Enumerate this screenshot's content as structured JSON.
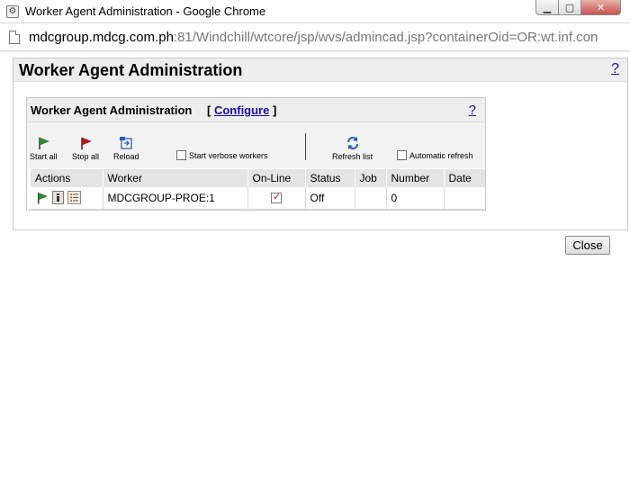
{
  "window": {
    "title": "Worker Agent Administration - Google Chrome",
    "url_host": "mdcgroup.mdcg.com.ph",
    "url_rest": ":81/Windchill/wtcore/jsp/wvs/admincad.jsp?containerOid=OR:wt.inf.con"
  },
  "page": {
    "title": "Worker Agent Administration",
    "help_label": "?"
  },
  "panel": {
    "title": "Worker Agent Administration",
    "configure_open": "[",
    "configure_label": "Configure",
    "configure_close": "]",
    "help_label": "?"
  },
  "toolbar": {
    "start_all": "Start all",
    "stop_all": "Stop all",
    "reload": "Reload",
    "verbose_label": "Start verbose workers",
    "refresh_list": "Refresh list",
    "auto_refresh_label": "Automatic refresh"
  },
  "table": {
    "columns": [
      "Actions",
      "Worker",
      "On-Line",
      "Status",
      "Job",
      "Number",
      "Date"
    ],
    "rows": [
      {
        "worker": "MDCGROUP-PROE:1",
        "online": true,
        "status": "Off",
        "job": "",
        "number": "0",
        "date": ""
      }
    ]
  },
  "close_label": "Close",
  "colors": {
    "link": "#1a0dab",
    "header_bg": "#eeeeee",
    "check_red": "#c01818"
  }
}
